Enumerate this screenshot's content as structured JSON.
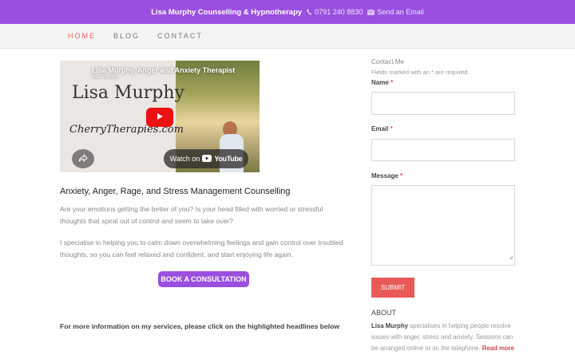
{
  "topbar": {
    "brand": "Lisa Murphy Counselling & Hypnotherapy",
    "phone": "0791 240 8830",
    "email": "Send an Email"
  },
  "nav": {
    "items": [
      "HOME",
      "BLOG",
      "CONTACT"
    ],
    "active": "HOME"
  },
  "video": {
    "title": "Lisa Murphy, Anger and Anxiety Therapist",
    "channel": "Lisa Murphy",
    "name_text": "Lisa Murphy",
    "site_text": "CherryTherapies.com",
    "watch_label": "Watch on",
    "youtube_label": "YouTube"
  },
  "main": {
    "heading": "Anxiety, Anger, Rage, and Stress Management Counselling",
    "para1": "Are your emotions getting the better of you? Is your head filled with worried or stressful thoughts that spiral out of control and seem to take over?",
    "para2": "I specialise in helping you to calm down overwhelming feelings and gain control over troubled thoughts, so you can feel relaxed and confident, and start enjoying life again.",
    "cta": "BOOK A CONSULTATION",
    "more_info": "For more information on my services, please click on the highlighted headlines below"
  },
  "contact_form": {
    "title": "Contact Me",
    "required_note": "Fields marked with an * are required",
    "name_label": "Name",
    "email_label": "Email",
    "message_label": "Message",
    "required_mark": "*",
    "submit": "SUBMIT"
  },
  "about": {
    "title": "ABOUT",
    "name": "Lisa Murphy",
    "text": " specialises in helping people resolve issues with anger, stress and anxiety. Sessions can be arranged online or on the telephone. ",
    "read_more": "Read more"
  },
  "colors": {
    "brand_purple": "#9b4fe0",
    "accent_red": "#e85a57"
  }
}
